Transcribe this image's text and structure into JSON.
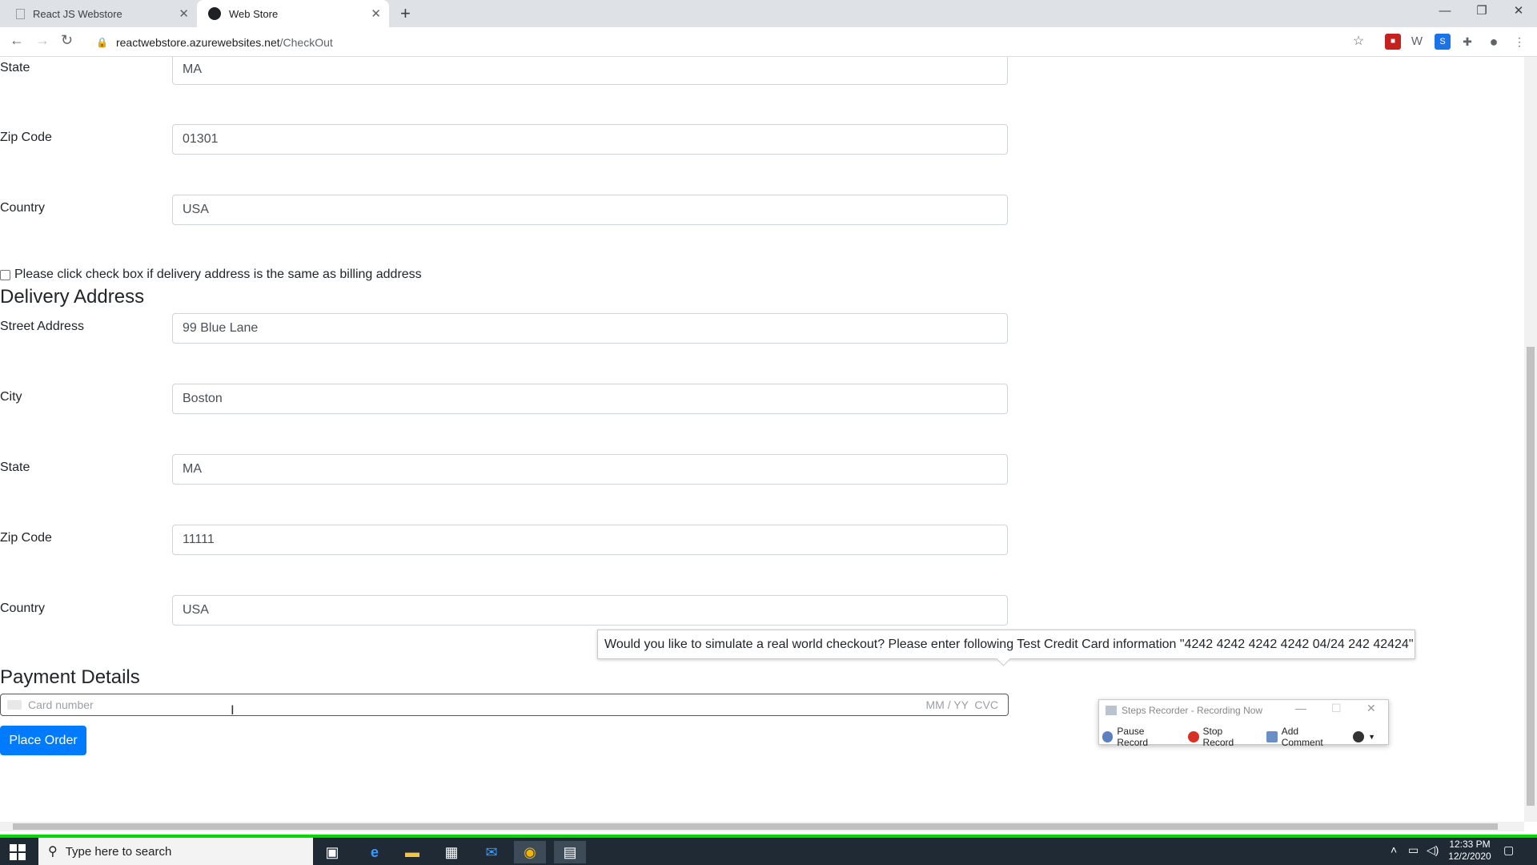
{
  "browser": {
    "tabs": [
      {
        "label": "React JS Webstore"
      },
      {
        "label": "Web Store"
      }
    ],
    "url_host": "reactwebstore.azurewebsites.net",
    "url_path": "/CheckOut"
  },
  "billing": {
    "state_label": "State",
    "state_value": "MA",
    "zip_label": "Zip Code",
    "zip_value": "01301",
    "country_label": "Country",
    "country_value": "USA"
  },
  "same_address_checkbox": {
    "label": "Please click check box if delivery address is the same as billing address",
    "checked": false
  },
  "delivery": {
    "heading": "Delivery Address",
    "street_label": "Street Address",
    "street_value": "99 Blue Lane",
    "city_label": "City",
    "city_value": "Boston",
    "state_label": "State",
    "state_value": "MA",
    "zip_label": "Zip Code",
    "zip_value": "11111",
    "country_label": "Country",
    "country_value": "USA"
  },
  "tooltip": {
    "text": "Would you like to simulate a real world checkout? Please enter following Test Credit Card information \"4242 4242 4242 4242 04/24 242 42424\""
  },
  "payment": {
    "heading": "Payment Details",
    "card_placeholder": "Card number",
    "card_right": "MM / YY  CVC",
    "place_order": "Place Order"
  },
  "steps_recorder": {
    "title": "Steps Recorder - Recording Now",
    "pause": "Pause Record",
    "stop": "Stop Record",
    "comment": "Add Comment"
  },
  "taskbar": {
    "search_placeholder": "Type here to search",
    "time": "12:33 PM",
    "date": "12/2/2020"
  },
  "colors": {
    "primary_button": "#007bff",
    "taskbar": "#1f2a35",
    "recording_bar": "#00d800"
  }
}
